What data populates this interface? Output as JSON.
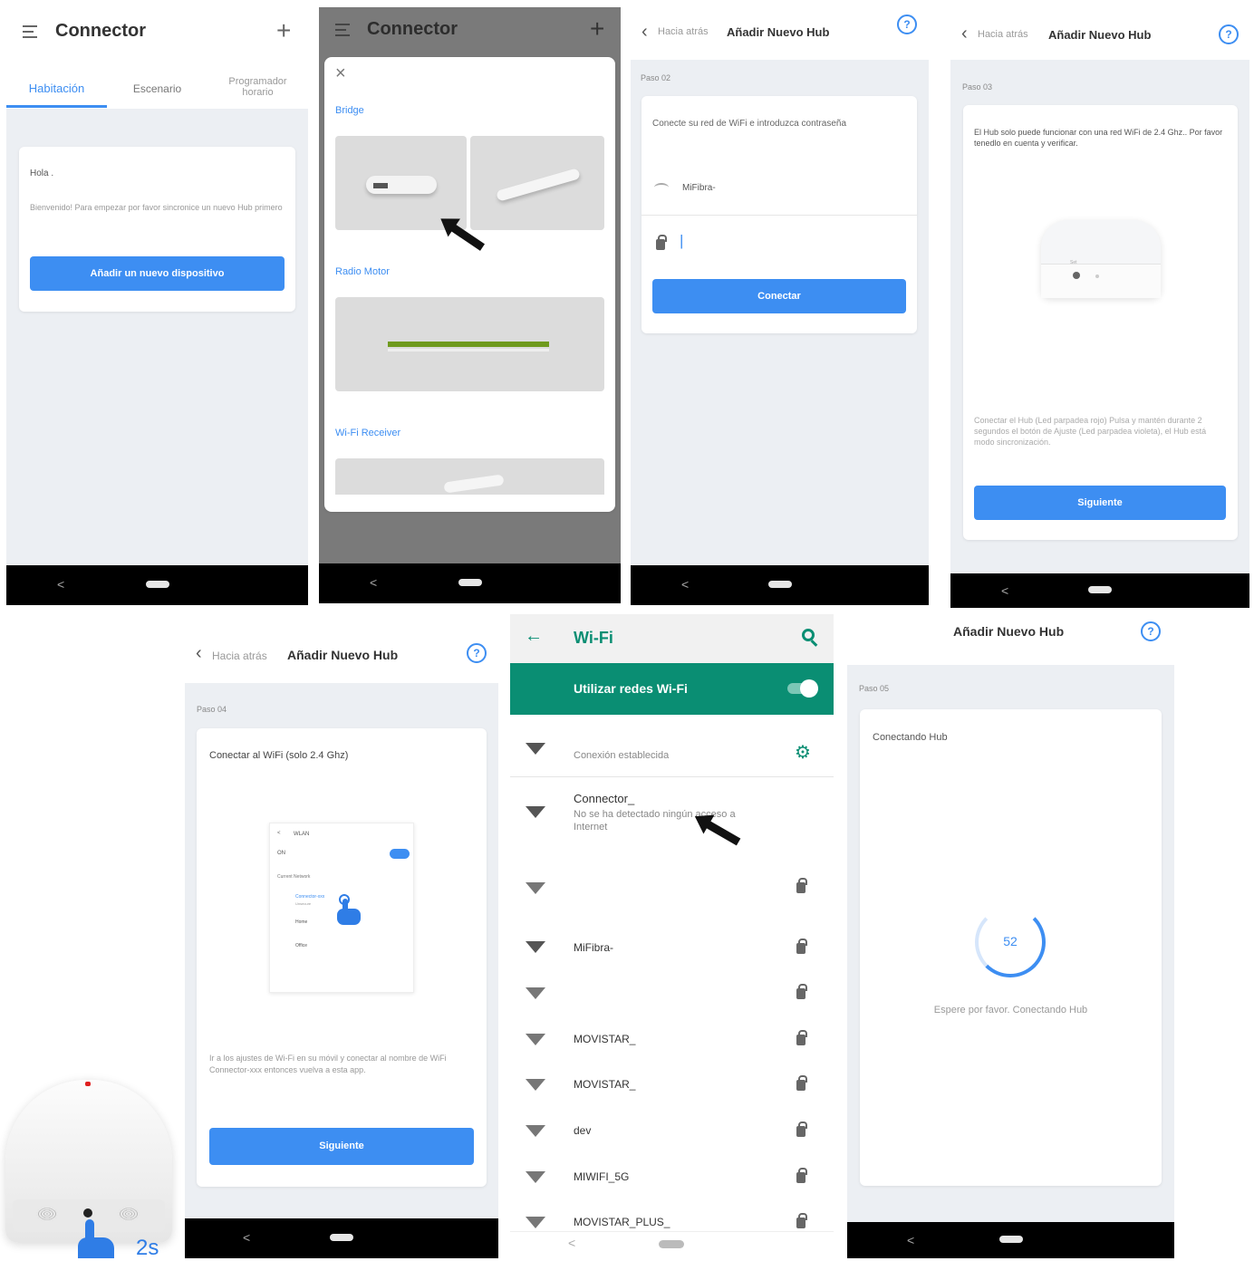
{
  "s1": {
    "title": "Connector",
    "tabs": [
      "Habitación",
      "Escenario",
      "Programador\nhorario"
    ],
    "greeting": "Hola .",
    "welcome": "Bienvenido! Para empezar por favor sincronice un nuevo Hub primero",
    "button": "Añadir un nuevo dispositivo"
  },
  "s2": {
    "title": "Connector",
    "sections": [
      "Bridge",
      "Radio Motor",
      "Wi-Fi Receiver"
    ]
  },
  "s3": {
    "back": "Hacia atrás",
    "title": "Añadir Nuevo Hub",
    "step": "Paso 02",
    "instruction": "Conecte su red de WiFi e introduzca contraseña",
    "network": "MiFibra-",
    "password": "|",
    "button": "Conectar"
  },
  "s4": {
    "back": "Hacia atrás",
    "title": "Añadir Nuevo Hub",
    "step": "Paso 03",
    "info": "El Hub solo puede funcionar con una red WiFi de 2.4 Ghz.. Por favor tenedlo en cuenta y verificar.",
    "device_label": "Set",
    "instruction": "Conectar el Hub (Led parpadea rojo) Pulsa y mantén durante 2 segundos el botón de Ajuste (Led parpadea violeta), el Hub está modo sincronización.",
    "button": "Siguiente"
  },
  "s5": {
    "back": "Hacia atrás",
    "title": "Añadir Nuevo Hub",
    "step": "Paso 04",
    "instruction": "Conectar al WiFi (solo 2.4 Ghz)",
    "mock": {
      "title": "WLAN",
      "on": "ON",
      "current": "Current Network",
      "items": [
        "Connector-xxx",
        "Home",
        "Office"
      ],
      "sub": "Unsecure"
    },
    "help": "Ir a los ajustes de Wi-Fi en su móvil y conectar al nombre de WiFi Connector-xxx entonces vuelva a esta app.",
    "button": "Siguiente",
    "hold": "2s"
  },
  "s6": {
    "title": "Wi-Fi",
    "toggle_label": "Utilizar redes Wi-Fi",
    "connected_status": "Conexión establecida",
    "connector_name": "Connector_",
    "connector_status": "No se ha detectado ningún acceso a Internet",
    "networks": [
      "MiFibra-",
      "MOVISTAR_",
      "MOVISTAR_",
      "dev",
      "MIWIFI_5G",
      "MOVISTAR_PLUS_"
    ]
  },
  "s7": {
    "title": "Añadir Nuevo Hub",
    "step": "Paso 05",
    "heading": "Conectando Hub",
    "progress": "52",
    "wait": "Espere por favor. Conectando Hub"
  }
}
